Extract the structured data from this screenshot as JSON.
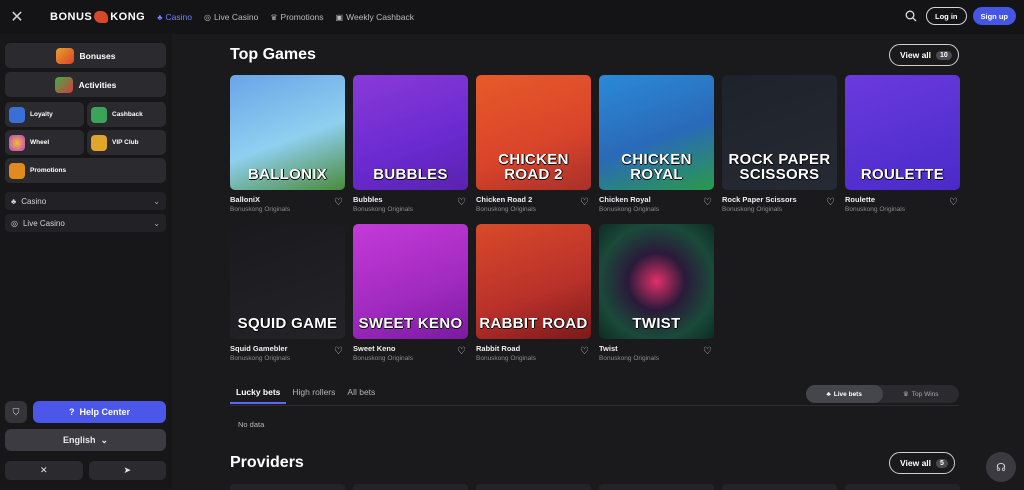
{
  "topbar": {
    "brand_left": "BONUS",
    "brand_right": "KONG",
    "nav": [
      {
        "label": "Casino",
        "icon": "casino-icon"
      },
      {
        "label": "Live Casino",
        "icon": "live-icon"
      },
      {
        "label": "Promotions",
        "icon": "crown-icon"
      },
      {
        "label": "Weekly Cashback",
        "icon": "cashback-icon"
      }
    ],
    "login": "Log in",
    "signup": "Sign up"
  },
  "sidebar": {
    "bonuses": "Bonuses",
    "activities": "Activities",
    "small": [
      {
        "label": "Loyalty",
        "color": "#3b6fd8"
      },
      {
        "label": "Cashback",
        "color": "#3aa55a"
      },
      {
        "label": "Wheel",
        "color": "#c13bd0"
      },
      {
        "label": "VIP Club",
        "color": "#e0a62a"
      },
      {
        "label": "Promotions",
        "color": "#e08a20"
      }
    ],
    "casino": "Casino",
    "live_casino": "Live Casino",
    "help": "Help Center",
    "language": "English"
  },
  "main": {
    "top_games_title": "Top Games",
    "view_all_label": "View all",
    "top_games_count": "10",
    "games": [
      {
        "name": "BalloniX",
        "sub": "Bonuskong Originals",
        "art": "BALLONIX",
        "bg": "linear-gradient(160deg,#6aa4e8,#8fd0f0 55%,#4a8a3a)"
      },
      {
        "name": "Bubbles",
        "sub": "Bonuskong Originals",
        "art": "BUBBLES",
        "bg": "linear-gradient(160deg,#8a3ad8,#6a2ad0 60%,#5a22b0)"
      },
      {
        "name": "Chicken Road 2",
        "sub": "Bonuskong Originals",
        "art": "CHICKEN ROAD 2",
        "bg": "linear-gradient(160deg,#e85a2a,#d8442a 60%,#a8302a)"
      },
      {
        "name": "Chicken Royal",
        "sub": "Bonuskong Originals",
        "art": "CHICKEN ROYAL",
        "bg": "linear-gradient(160deg,#2a8ad8,#2a6ab8 55%,#2a9a4a)"
      },
      {
        "name": "Rock Paper Scissors",
        "sub": "Bonuskong Originals",
        "art": "ROCK PAPER SCISSORS",
        "bg": "linear-gradient(160deg,#1e222a,#262a34)"
      },
      {
        "name": "Roulette",
        "sub": "Bonuskong Originals",
        "art": "ROULETTE",
        "bg": "linear-gradient(160deg,#6a3ae0,#4a2ac8)"
      },
      {
        "name": "Squid Gamebler",
        "sub": "Bonuskong Originals",
        "art": "SQUID GAME",
        "bg": "linear-gradient(160deg,#1a1a1e,#242428)"
      },
      {
        "name": "Sweet Keno",
        "sub": "Bonuskong Originals",
        "art": "SWEET KENO",
        "bg": "linear-gradient(160deg,#c43ad8,#a02ac0 60%,#7a1aa0)"
      },
      {
        "name": "Rabbit Road",
        "sub": "Bonuskong Originals",
        "art": "RABBIT ROAD",
        "bg": "linear-gradient(160deg,#d84a2a,#b8302a 60%,#7a1a1a)"
      },
      {
        "name": "Twist",
        "sub": "Bonuskong Originals",
        "art": "TWIST",
        "bg": "radial-gradient(circle at 50% 50%,#e0306a 0%,#2a1a3a 35%,#1a4a3a 70%,#0e2a22 100%)"
      }
    ],
    "bets_tabs": [
      "Lucky bets",
      "High rollers",
      "All bets"
    ],
    "live_bets": "Live bets",
    "top_wins": "Top Wins",
    "no_data": "No data",
    "providers_title": "Providers",
    "providers_count": "5"
  }
}
